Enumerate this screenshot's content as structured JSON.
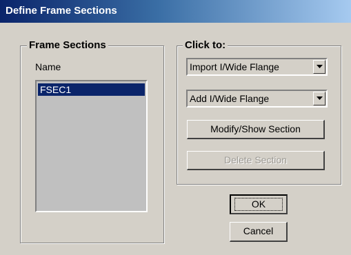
{
  "window": {
    "title": "Define Frame Sections"
  },
  "frame_sections": {
    "legend": "Frame Sections",
    "name_label": "Name",
    "list_items": [
      "FSEC1"
    ],
    "selected_item": "FSEC1"
  },
  "click_to": {
    "legend": "Click to:",
    "import_dropdown": {
      "value": "Import I/Wide Flange"
    },
    "add_dropdown": {
      "value": "Add I/Wide Flange"
    },
    "modify_button": "Modify/Show Section",
    "delete_button": "Delete Section"
  },
  "footer": {
    "ok_button": "OK",
    "cancel_button": "Cancel"
  },
  "colors": {
    "title_bar_start": "#0a246a",
    "title_bar_end": "#a6caf0",
    "dialog_face": "#d4d0c8",
    "selection": "#0a246a"
  },
  "icons": {
    "dropdown_arrow": "chevron-down-icon"
  }
}
